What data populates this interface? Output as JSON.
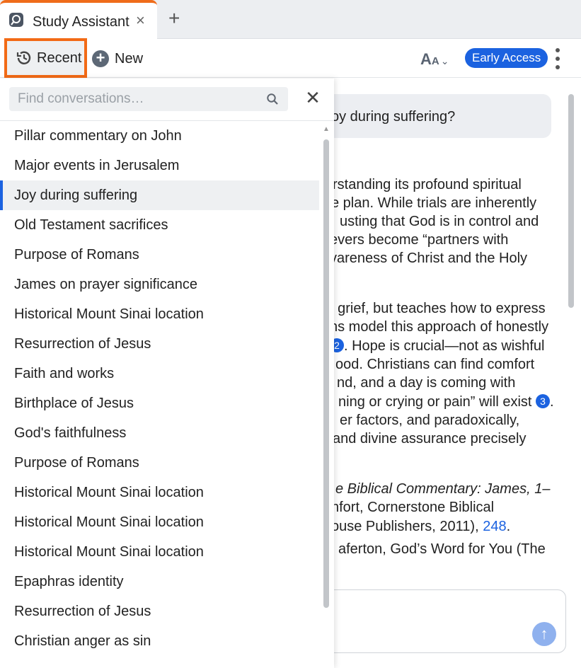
{
  "tab": {
    "title": "Study Assistant",
    "close": "×",
    "new_tab": "+"
  },
  "toolbar": {
    "recent_label": "Recent",
    "new_label": "New",
    "new_icon": "+",
    "font_size": {
      "big": "A",
      "small": "A",
      "chevron": "⌄"
    },
    "early_access": "Early Access"
  },
  "panel": {
    "search_placeholder": "Find conversations…",
    "close": "✕",
    "conversations": [
      {
        "title": "Pillar commentary on John",
        "selected": false
      },
      {
        "title": "Major events in Jerusalem",
        "selected": false
      },
      {
        "title": "Joy during suffering",
        "selected": true
      },
      {
        "title": "Old Testament sacrifices",
        "selected": false
      },
      {
        "title": "Purpose of Romans",
        "selected": false
      },
      {
        "title": "James on prayer significance",
        "selected": false
      },
      {
        "title": "Historical Mount Sinai location",
        "selected": false
      },
      {
        "title": "Resurrection of Jesus",
        "selected": false
      },
      {
        "title": "Faith and works",
        "selected": false
      },
      {
        "title": "Birthplace of Jesus",
        "selected": false
      },
      {
        "title": "God's faithfulness",
        "selected": false
      },
      {
        "title": "Purpose of Romans",
        "selected": false
      },
      {
        "title": "Historical Mount Sinai location",
        "selected": false
      },
      {
        "title": "Historical Mount Sinai location",
        "selected": false
      },
      {
        "title": "Historical Mount Sinai location",
        "selected": false
      },
      {
        "title": "Epaphras identity",
        "selected": false
      },
      {
        "title": "Resurrection of Jesus",
        "selected": false
      },
      {
        "title": "Christian anger as sin",
        "selected": false
      }
    ]
  },
  "chat": {
    "question_fragment": "oy during suffering?",
    "answer_lines": [
      "rstanding its profound spiritual",
      "e plan. While trials are inherently",
      "usting that God is in control and",
      "evers become “partners with",
      "vareness of Christ and the Holy",
      "f grief, but teaches how to express",
      "ns model this approach of honestly",
      ". Hope is crucial—not as wishful",
      "ood. Christians can find comfort",
      "nd, and a day is coming with",
      "ning or crying or pain” will exist",
      "er factors, and paradoxically,",
      " and divine assurance precisely"
    ],
    "citations": [
      "2",
      "3"
    ],
    "footnote_1_a": "e Biblical Commentary: James, 1–",
    "footnote_1_b": "nfort, Cornerstone Biblical",
    "footnote_1_c": "ouse Publishers, 2011), ",
    "footnote_1_page": "248",
    "footnote_1_end": ".",
    "footnote_2": "aferton, God’s Word for You (The",
    "send_icon": "↑"
  },
  "colors": {
    "accent": "#1b62e0",
    "highlight": "#f26a16"
  }
}
